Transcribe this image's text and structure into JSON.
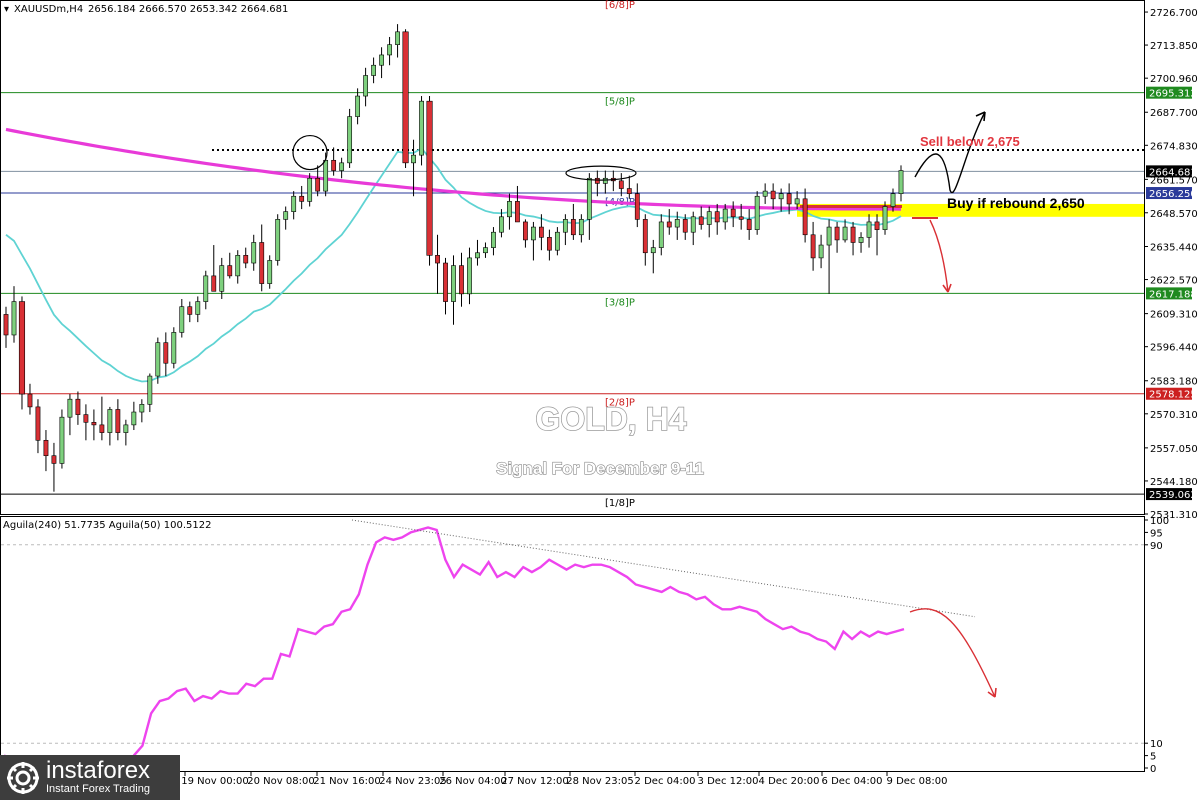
{
  "header": {
    "symbol": "XAUUSDm,H4",
    "ohlc": "2656.184 2666.570 2653.342 2664.681"
  },
  "indicator_header": "Aguila(240) 51.7735  Aguila(50) 100.5122",
  "labels": {
    "title": "GOLD, H4",
    "subtitle": "Signal For December 9-11",
    "sell": "Sell below 2,675",
    "buy": "Buy if rebound 2,650"
  },
  "logo": {
    "name": "instaforex",
    "tagline": "Instant Forex Trading"
  },
  "colors": {
    "bull": "#7ed07e",
    "bear": "#d93035",
    "sma200": "#e83ad8",
    "ema21": "#5fd3d3",
    "murrey_green": "#1f8a1f",
    "murrey_red": "#cc2020",
    "zone": "#ffff00",
    "oscillator": "#ee44ee"
  },
  "chart_data": [
    {
      "type": "candlestick",
      "symbol": "XAUUSDm",
      "timeframe": "H4",
      "ylim": [
        2531.31,
        2731.0
      ],
      "y_ticks": [
        2726.7,
        2713.85,
        2700.96,
        2687.7,
        2674.83,
        2661.57,
        2648.57,
        2635.44,
        2622.57,
        2609.31,
        2596.44,
        2583.18,
        2570.31,
        2557.05,
        2544.18,
        2531.31
      ],
      "y_tick_labels": [
        "2726.700",
        "2713.850",
        "2700.960",
        "2687.700",
        "2674.830",
        "2661.570",
        "2648.570",
        "2635.440",
        "2622.570",
        "2609.310",
        "2596.440",
        "2583.180",
        "2570.310",
        "2557.050",
        "2544.180",
        "2531.310"
      ],
      "x_labels": [
        "19 Nov 00:00",
        "20 Nov 08:00",
        "21 Nov 16:00",
        "24 Nov 23:05",
        "26 Nov 04:00",
        "27 Nov 12:00",
        "28 Nov 23:05",
        "2 Dec 04:00",
        "3 Dec 12:00",
        "4 Dec 20:00",
        "6 Dec 04:00",
        "9 Dec 08:00"
      ],
      "murrey_levels": [
        {
          "label": "[6/8]P",
          "value": 2733.0,
          "color": "red"
        },
        {
          "label": "[5/8]P",
          "value": 2695.312,
          "color": "green",
          "price_tag": "2695.312"
        },
        {
          "label": "[4/8]P",
          "value": 2656.25,
          "color": "blue",
          "price_tag": "2656.250"
        },
        {
          "label": "[3/8]P",
          "value": 2617.188,
          "color": "green",
          "price_tag": "2617.188"
        },
        {
          "label": "[2/8]P",
          "value": 2578.125,
          "color": "red",
          "price_tag": "2578.125"
        },
        {
          "label": "[1/8]P",
          "value": 2539.062,
          "color": "black",
          "price_tag": "2539.062"
        }
      ],
      "current_price": 2664.681,
      "resistance_dotted": 2673.0,
      "buy_zone": [
        2647.0,
        2652.0
      ],
      "candles": [
        [
          2609,
          2612,
          2596,
          2601
        ],
        [
          2601,
          2620,
          2598,
          2614
        ],
        [
          2614,
          2616,
          2572,
          2578
        ],
        [
          2578,
          2582,
          2570,
          2573
        ],
        [
          2573,
          2576,
          2555,
          2560
        ],
        [
          2560,
          2564,
          2548,
          2554
        ],
        [
          2554,
          2559,
          2540,
          2551
        ],
        [
          2551,
          2572,
          2549,
          2569
        ],
        [
          2569,
          2578,
          2562,
          2576
        ],
        [
          2576,
          2579,
          2566,
          2570
        ],
        [
          2570,
          2574,
          2560,
          2567
        ],
        [
          2567,
          2572,
          2560,
          2566
        ],
        [
          2566,
          2577,
          2560,
          2563
        ],
        [
          2563,
          2573,
          2558,
          2572
        ],
        [
          2572,
          2576,
          2560,
          2563
        ],
        [
          2563,
          2568,
          2558,
          2566
        ],
        [
          2566,
          2575,
          2564,
          2571
        ],
        [
          2571,
          2576,
          2567,
          2574
        ],
        [
          2574,
          2586,
          2571,
          2585
        ],
        [
          2585,
          2600,
          2582,
          2598
        ],
        [
          2598,
          2602,
          2585,
          2590
        ],
        [
          2590,
          2604,
          2588,
          2602
        ],
        [
          2602,
          2615,
          2600,
          2612
        ],
        [
          2612,
          2614,
          2606,
          2609
        ],
        [
          2609,
          2616,
          2606,
          2614
        ],
        [
          2614,
          2626,
          2611,
          2624
        ],
        [
          2624,
          2636,
          2620,
          2618
        ],
        [
          2618,
          2631,
          2615,
          2628
        ],
        [
          2628,
          2633,
          2623,
          2624
        ],
        [
          2624,
          2634,
          2621,
          2632
        ],
        [
          2632,
          2635,
          2627,
          2629
        ],
        [
          2629,
          2640,
          2626,
          2637
        ],
        [
          2637,
          2644,
          2618,
          2621
        ],
        [
          2621,
          2632,
          2619,
          2630
        ],
        [
          2630,
          2648,
          2628,
          2646
        ],
        [
          2646,
          2651,
          2642,
          2649
        ],
        [
          2649,
          2657,
          2646,
          2655
        ],
        [
          2655,
          2659,
          2650,
          2653
        ],
        [
          2653,
          2664,
          2651,
          2662
        ],
        [
          2662,
          2667,
          2655,
          2657
        ],
        [
          2657,
          2672,
          2655,
          2669
        ],
        [
          2669,
          2674,
          2663,
          2665
        ],
        [
          2665,
          2670,
          2662,
          2668
        ],
        [
          2668,
          2689,
          2666,
          2686
        ],
        [
          2686,
          2697,
          2683,
          2694
        ],
        [
          2694,
          2705,
          2690,
          2702
        ],
        [
          2702,
          2709,
          2699,
          2706
        ],
        [
          2706,
          2713,
          2701,
          2710
        ],
        [
          2710,
          2717,
          2706,
          2714
        ],
        [
          2714,
          2722,
          2709,
          2719
        ],
        [
          2719,
          2720,
          2666,
          2668
        ],
        [
          2668,
          2677,
          2655,
          2671
        ],
        [
          2671,
          2694,
          2667,
          2692
        ],
        [
          2692,
          2694,
          2628,
          2632
        ],
        [
          2632,
          2640,
          2617,
          2629
        ],
        [
          2629,
          2631,
          2609,
          2614
        ],
        [
          2614,
          2632,
          2605,
          2628
        ],
        [
          2628,
          2633,
          2612,
          2617
        ],
        [
          2617,
          2635,
          2613,
          2631
        ],
        [
          2631,
          2638,
          2628,
          2633
        ],
        [
          2633,
          2637,
          2631,
          2635
        ],
        [
          2635,
          2643,
          2632,
          2641
        ],
        [
          2641,
          2650,
          2639,
          2647
        ],
        [
          2647,
          2656,
          2642,
          2653
        ],
        [
          2653,
          2659,
          2648,
          2645
        ],
        [
          2645,
          2646,
          2635,
          2638
        ],
        [
          2638,
          2645,
          2630,
          2643
        ],
        [
          2643,
          2648,
          2634,
          2639
        ],
        [
          2639,
          2642,
          2630,
          2634
        ],
        [
          2634,
          2643,
          2632,
          2641
        ],
        [
          2641,
          2648,
          2636,
          2646
        ],
        [
          2646,
          2652,
          2638,
          2640
        ],
        [
          2640,
          2648,
          2637,
          2646
        ],
        [
          2646,
          2664,
          2638,
          2662
        ],
        [
          2662,
          2665,
          2655,
          2660
        ],
        [
          2660,
          2665,
          2656,
          2662
        ],
        [
          2662,
          2665,
          2657,
          2661
        ],
        [
          2661,
          2664,
          2655,
          2658
        ],
        [
          2658,
          2663,
          2654,
          2656
        ],
        [
          2656,
          2660,
          2643,
          2646
        ],
        [
          2646,
          2648,
          2628,
          2633
        ],
        [
          2633,
          2638,
          2625,
          2635
        ],
        [
          2635,
          2648,
          2632,
          2645
        ],
        [
          2645,
          2650,
          2640,
          2643
        ],
        [
          2643,
          2649,
          2638,
          2646
        ],
        [
          2646,
          2648,
          2638,
          2641
        ],
        [
          2641,
          2649,
          2636,
          2647
        ],
        [
          2647,
          2651,
          2642,
          2644
        ],
        [
          2644,
          2651,
          2639,
          2649
        ],
        [
          2649,
          2652,
          2640,
          2645
        ],
        [
          2645,
          2652,
          2642,
          2650
        ],
        [
          2650,
          2653,
          2643,
          2647
        ],
        [
          2647,
          2652,
          2642,
          2646
        ],
        [
          2646,
          2650,
          2638,
          2642
        ],
        [
          2642,
          2657,
          2640,
          2655
        ],
        [
          2655,
          2660,
          2652,
          2657
        ],
        [
          2657,
          2660,
          2650,
          2654
        ],
        [
          2654,
          2658,
          2649,
          2656
        ],
        [
          2656,
          2660,
          2648,
          2652
        ],
        [
          2652,
          2657,
          2650,
          2654
        ],
        [
          2654,
          2658,
          2637,
          2640
        ],
        [
          2640,
          2645,
          2626,
          2631
        ],
        [
          2631,
          2640,
          2627,
          2636
        ],
        [
          2636,
          2646,
          2617,
          2643
        ],
        [
          2643,
          2645,
          2633,
          2638
        ],
        [
          2638,
          2646,
          2637,
          2643
        ],
        [
          2643,
          2645,
          2632,
          2637
        ],
        [
          2637,
          2641,
          2633,
          2639
        ],
        [
          2639,
          2648,
          2635,
          2645
        ],
        [
          2645,
          2648,
          2632,
          2642
        ],
        [
          2642,
          2653,
          2640,
          2651
        ],
        [
          2651,
          2658,
          2649,
          2656
        ],
        [
          2656,
          2667,
          2653,
          2665
        ]
      ]
    },
    {
      "type": "line",
      "name": "Aguila(240)",
      "ylim": [
        0,
        100
      ],
      "y_ticks": [
        100,
        95,
        90,
        10,
        5,
        0
      ],
      "values": [
        5,
        4,
        2,
        1,
        0,
        0,
        1,
        2,
        3,
        2,
        3,
        3,
        3,
        2,
        2,
        5,
        9,
        22,
        27,
        28,
        31,
        32,
        27,
        29,
        28,
        31,
        30,
        30,
        34,
        33,
        36,
        36,
        46,
        45,
        56,
        55,
        54,
        57,
        58,
        63,
        64,
        70,
        82,
        91,
        93,
        92,
        93,
        95,
        96,
        97,
        96,
        84,
        77,
        82,
        80,
        78,
        83,
        77,
        79,
        77,
        81,
        79,
        81,
        84,
        82,
        80,
        82,
        81,
        82,
        82,
        81,
        79,
        77,
        74,
        73,
        72,
        71,
        73,
        71,
        70,
        68,
        69,
        66,
        64,
        64,
        65,
        64,
        63,
        60,
        58,
        56,
        57,
        55,
        54,
        52,
        51,
        48,
        55,
        52,
        55,
        53,
        55,
        54,
        55,
        56
      ]
    }
  ]
}
